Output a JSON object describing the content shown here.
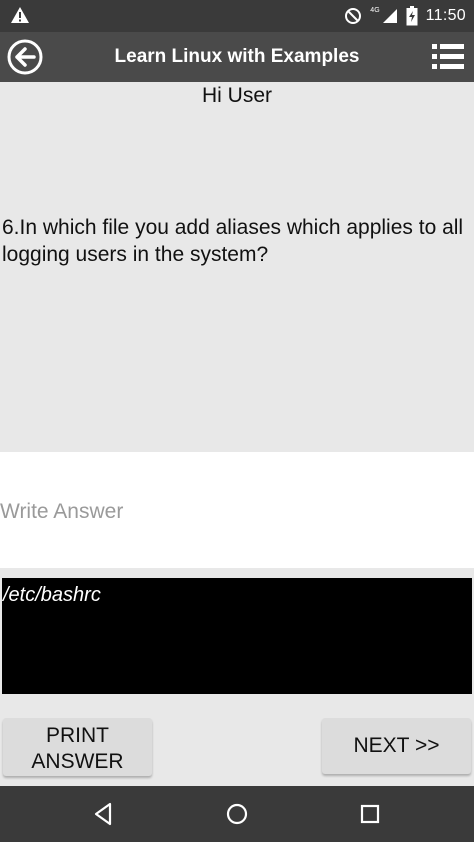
{
  "status_bar": {
    "time": "11:50",
    "network": "4G",
    "icons": [
      "warning-icon",
      "do-not-disturb-icon",
      "signal-icon",
      "battery-icon"
    ]
  },
  "app_bar": {
    "title": "Learn Linux with Examples",
    "icons": [
      "back-circle-arrow-icon",
      "list-menu-icon"
    ]
  },
  "greeting": "Hi User",
  "question": "6.In which file you add aliases which applies to all logging users in the system?",
  "answer_input": {
    "placeholder": "Write Answer",
    "value": ""
  },
  "answer_display": "/etc/bashrc",
  "buttons": {
    "print_answer": "PRINT ANSWER",
    "next": "NEXT >>"
  },
  "nav_bar": {
    "icons": [
      "nav-back-icon",
      "nav-home-icon",
      "nav-recents-icon"
    ]
  },
  "colors": {
    "status_bar": "#3a3a3a",
    "app_bar": "#4a4a4a",
    "content_bg": "#e8e8e8",
    "answer_box": "#000000",
    "button_bg": "#dcdcdc"
  }
}
